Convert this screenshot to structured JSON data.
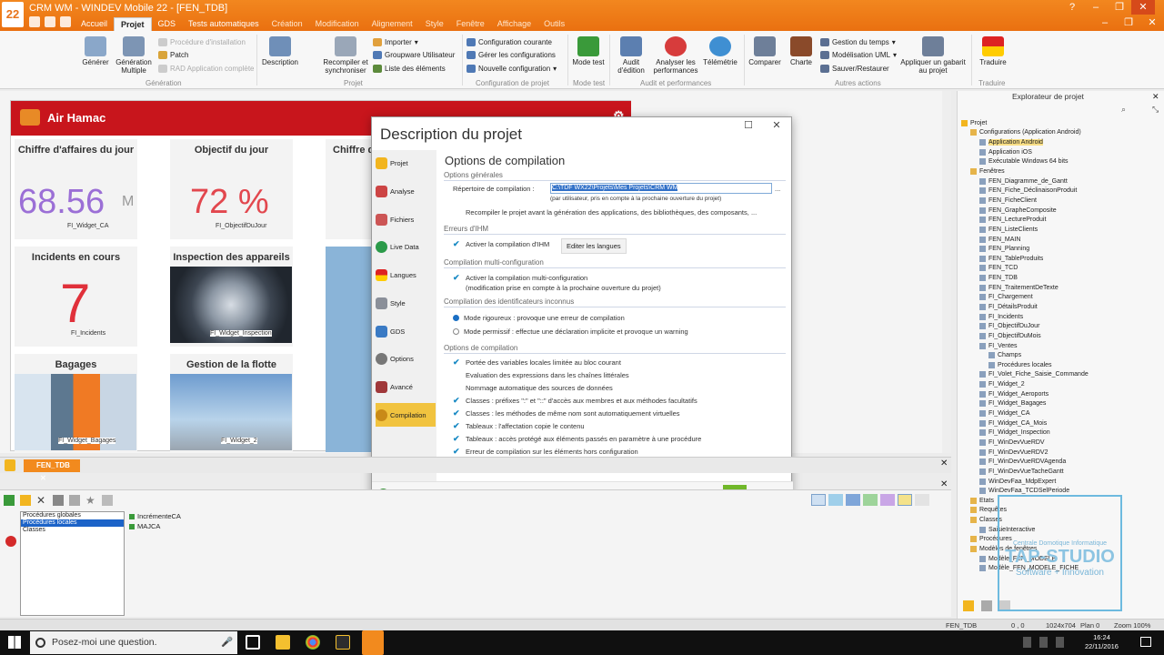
{
  "window": {
    "title": "CRM WM - WINDEV Mobile 22 - [FEN_TDB]",
    "logo_text": "22",
    "controls": [
      "?",
      "–",
      "❐",
      "✕",
      "–",
      "❐",
      "✕"
    ]
  },
  "ribbon": {
    "tabs": [
      "Accueil",
      "Projet",
      "GDS",
      "Tests automatiques",
      "Création",
      "Modification",
      "Alignement",
      "Style",
      "Fenêtre",
      "Affichage",
      "Outils"
    ],
    "groups": [
      {
        "name": "Génération",
        "buttons": [
          "Générer",
          "Génération Multiple"
        ],
        "small": [
          "Procédure d'installation",
          "Patch",
          "RAD Application complète"
        ]
      },
      {
        "name": "Projet",
        "buttons": [
          "Description",
          "Recompiler et synchroniser"
        ],
        "small": [
          "Importer",
          "Groupware Utilisateur",
          "Liste des éléments"
        ]
      },
      {
        "name": "Configuration de projet",
        "small": [
          "Configuration courante",
          "Gérer les configurations",
          "Nouvelle configuration"
        ]
      },
      {
        "name": "Mode test",
        "buttons": [
          "Mode test"
        ]
      },
      {
        "name": "Audit et performances",
        "buttons": [
          "Audit d'édition",
          "Analyser les performances",
          "Télémétrie"
        ]
      },
      {
        "name": "Autres actions",
        "buttons": [
          "Comparer",
          "Charte",
          "Appliquer un gabarit au projet"
        ],
        "small": [
          "Gestion du temps",
          "Modélisation UML",
          "Sauver/Restaurer"
        ]
      },
      {
        "name": "Traduire",
        "buttons": [
          "Traduire"
        ]
      }
    ]
  },
  "window_preview": {
    "app_name": "Air Hamac",
    "tiles": [
      {
        "title": "Chiffre d'affaires du jour",
        "value": "68.56",
        "unit": "M",
        "sub": "FI_Widget_CA",
        "color": "#9b6fd6"
      },
      {
        "title": "Objectif du jour",
        "value": "72 %",
        "sub": "FI_ObjectifDuJour",
        "color": "#e2474e"
      },
      {
        "title": "Chiffre d'",
        "value": "",
        "sub": ""
      },
      {
        "title": "Incidents en cours",
        "value": "7",
        "sub": "FI_Incidents",
        "color": "#e0303a"
      },
      {
        "title": "Inspection des appareils",
        "sub": "FI_Widget_Inspection"
      },
      {
        "title": "Bagages",
        "sub": "FI_Widget_Bagages"
      },
      {
        "title": "Gestion de la flotte",
        "sub": "FI_Widget_2"
      }
    ]
  },
  "dialog": {
    "title": "Description du projet",
    "sidebar": [
      "Projet",
      "Analyse",
      "Fichiers",
      "Live Data",
      "Langues",
      "Style",
      "GDS",
      "Options",
      "Avancé",
      "Compilation"
    ],
    "selected_sidebar": "Compilation",
    "heading": "Options de compilation",
    "sections": {
      "general": "Options générales",
      "ihm": "Erreurs d'IHM",
      "multi": "Compilation multi-configuration",
      "idents": "Compilation des identificateurs inconnus",
      "compile": "Options de compilation"
    },
    "repertoire_label": "Répertoire de compilation :",
    "repertoire_value": "C:\\TDF WX22\\Projets\\Mes Projets\\CRM WM",
    "repertoire_note": "(par utilisateur, pris en compte à la prochaine ouverture du projet)",
    "browse_label": "...",
    "recompile_label": "Recompiler le projet avant la génération des applications, des bibliothèques, des composants, ...",
    "ihm_label": "Activer la compilation d'IHM",
    "edit_languages": "Editer les langues",
    "multi_label": "Activer la compilation multi-configuration",
    "multi_note": "(modification prise en compte à la prochaine ouverture du projet)",
    "radio_strict": "Mode rigoureux : provoque une erreur de compilation",
    "radio_permissive": "Mode permissif : effectue une déclaration implicite et provoque un warning",
    "compile_options": [
      {
        "label": "Portée des variables locales limitée au bloc courant",
        "checked": true
      },
      {
        "label": "Evaluation des expressions dans les chaînes littérales",
        "checked": false
      },
      {
        "label": "Nommage automatique des sources de données",
        "checked": false
      },
      {
        "label": "Classes : préfixes \":\" et \"::\" d'accès aux membres et aux méthodes facultatifs",
        "checked": true
      },
      {
        "label": "Classes : les méthodes de même nom sont automatiquement virtuelles",
        "checked": true
      },
      {
        "label": "Tableaux : l'affectation copie le contenu",
        "checked": true
      },
      {
        "label": "Tableaux : accès protégé aux éléments passés en paramètre à une procédure",
        "checked": true
      },
      {
        "label": "Erreur de compilation sur les éléments hors configuration",
        "checked": true
      }
    ],
    "ok": "✔",
    "cancel": "✕",
    "help": "?"
  },
  "tabbar": {
    "tab": "FEN_TDB"
  },
  "procedures": {
    "list": [
      "Procédures globales",
      "Procédures locales",
      "Classes"
    ],
    "selected": "Procédures locales",
    "items": [
      "IncrémenteCA",
      "MAJCA"
    ]
  },
  "explorer": {
    "title": "Explorateur de projet",
    "tree": [
      {
        "label": "Projet",
        "level": 0
      },
      {
        "label": "Configurations (Application Android)",
        "level": 1
      },
      {
        "label": "Application Android",
        "level": 2,
        "selected": true
      },
      {
        "label": "Application iOS",
        "level": 2
      },
      {
        "label": "Exécutable Windows 64 bits",
        "level": 2
      },
      {
        "label": "Fenêtres",
        "level": 1
      },
      {
        "label": "FEN_Diagramme_de_Gantt",
        "level": 2
      },
      {
        "label": "FEN_Fiche_DéclinaisonProduit",
        "level": 2
      },
      {
        "label": "FEN_FicheClient",
        "level": 2
      },
      {
        "label": "FEN_GrapheComposite",
        "level": 2
      },
      {
        "label": "FEN_LectureProduit",
        "level": 2
      },
      {
        "label": "FEN_ListeClients",
        "level": 2
      },
      {
        "label": "FEN_MAIN",
        "level": 2
      },
      {
        "label": "FEN_Planning",
        "level": 2
      },
      {
        "label": "FEN_TableProduits",
        "level": 2
      },
      {
        "label": "FEN_TCD",
        "level": 2
      },
      {
        "label": "FEN_TDB",
        "level": 2
      },
      {
        "label": "FEN_TraitementDeTexte",
        "level": 2
      },
      {
        "label": "FI_Chargement",
        "level": 2
      },
      {
        "label": "FI_DétailsProduit",
        "level": 2
      },
      {
        "label": "FI_Incidents",
        "level": 2
      },
      {
        "label": "FI_ObjectifDuJour",
        "level": 2
      },
      {
        "label": "FI_ObjectifDuMois",
        "level": 2
      },
      {
        "label": "FI_Ventes",
        "level": 2
      },
      {
        "label": "Champs",
        "level": 3
      },
      {
        "label": "Procédures locales",
        "level": 3
      },
      {
        "label": "FI_Volet_Fiche_Saisie_Commande",
        "level": 2
      },
      {
        "label": "FI_Widget_2",
        "level": 2
      },
      {
        "label": "FI_Widget_Aeroports",
        "level": 2
      },
      {
        "label": "FI_Widget_Bagages",
        "level": 2
      },
      {
        "label": "FI_Widget_CA",
        "level": 2
      },
      {
        "label": "FI_Widget_CA_Mois",
        "level": 2
      },
      {
        "label": "FI_Widget_Inspection",
        "level": 2
      },
      {
        "label": "FI_WinDevVueRDV",
        "level": 2
      },
      {
        "label": "FI_WinDevVueRDV2",
        "level": 2
      },
      {
        "label": "FI_WinDevVueRDVAgenda",
        "level": 2
      },
      {
        "label": "FI_WinDevVueTacheGantt",
        "level": 2
      },
      {
        "label": "WinDevFaa_MdpExpert",
        "level": 2
      },
      {
        "label": "WinDevFaa_TCDSelPeriode",
        "level": 2
      },
      {
        "label": "Etats",
        "level": 1
      },
      {
        "label": "Requêtes",
        "level": 1
      },
      {
        "label": "Classes",
        "level": 1
      },
      {
        "label": "SaisieInteractive",
        "level": 2
      },
      {
        "label": "Procédures",
        "level": 1
      },
      {
        "label": "Modèles de fenêtres",
        "level": 1
      },
      {
        "label": "Modèle_FEN_MODELE",
        "level": 2
      },
      {
        "label": "Modèle_FEN_MODELE_FICHE",
        "level": 2
      }
    ]
  },
  "watermark": {
    "name": "TAP-STUDIO",
    "tagline": "Software + Innovation",
    "sub": "Centrale Domotique Informatique"
  },
  "statusbar": {
    "window": "FEN_TDB",
    "coords": "0 , 0",
    "size": "1024x704",
    "plan": "Plan 0",
    "zoom": "Zoom 100%"
  },
  "taskbar": {
    "search_placeholder": "Posez-moi une question.",
    "time": "16:24",
    "date": "22/11/2016"
  },
  "colors": {
    "orange": "#f28a1e",
    "red_header": "#c8151c",
    "selection_yellow": "#f1c33f",
    "check_blue": "#1a8ac4"
  }
}
